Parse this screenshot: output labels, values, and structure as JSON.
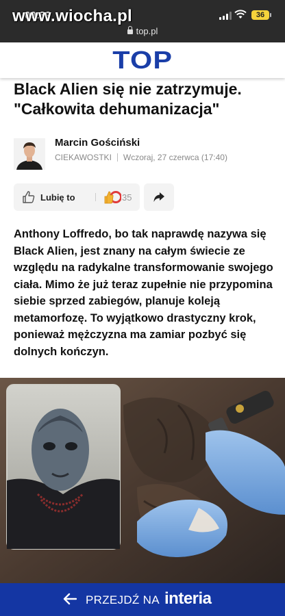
{
  "status_bar": {
    "time": "09:39",
    "watermark": "www.wiocha.pl",
    "battery": "36",
    "url": "top.pl"
  },
  "header": {
    "logo": "TOP",
    "logo_color": "#1a3ea8"
  },
  "article": {
    "title": "Black Alien się nie zatrzymuje. \"Całkowita dehumanizacja\"",
    "author": "Marcin Gościński",
    "category": "CIEKAWOSTKI",
    "date": "Wczoraj, 27 czerwca (17:40)",
    "like_label": "Lubię to",
    "like_count": "35",
    "lead": "Anthony Loffredo, bo tak naprawdę nazywa się Black Alien, jest znany na całym świecie ze względu na radykalne transformowanie swojego ciała. Mimo że już teraz zupełnie nie przypomina siebie sprzed zabiegów, planuje koleją metamorfozę. To wyjątkowo drastyczny krok, ponieważ mężczyzna ma zamiar pozbyć się dolnych kończyn."
  },
  "bottom_bar": {
    "go_label": "PRZEJDŹ NA",
    "brand": "interia",
    "background": "#1436a3"
  },
  "icons": {
    "thumb": "thumbs-up-icon",
    "reactions": "reaction-icons",
    "share": "share-arrow-icon",
    "back": "arrow-left-icon",
    "lock": "lock-icon",
    "wifi": "wifi-icon",
    "signal": "signal-icon"
  }
}
